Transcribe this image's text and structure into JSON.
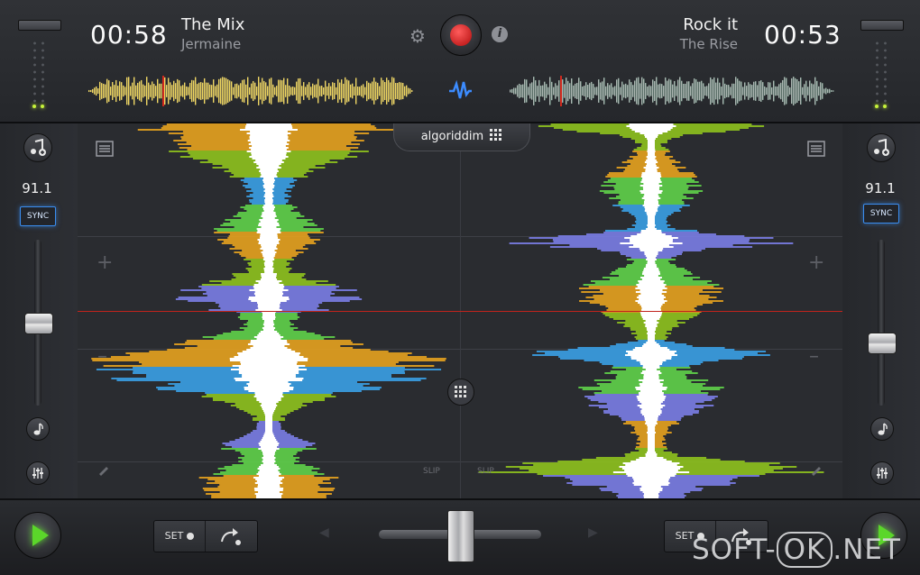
{
  "deck_a": {
    "time": "00:58",
    "title": "The Mix",
    "artist": "Jermaine",
    "bpm": "91.1",
    "sync_label": "SYNC",
    "set_label": "SET",
    "slip_label": "SLIP",
    "pitch_position": 0.5
  },
  "deck_b": {
    "time": "00:53",
    "title": "Rock it",
    "artist": "The Rise",
    "bpm": "91.1",
    "sync_label": "SYNC",
    "set_label": "SET",
    "slip_label": "SLIP",
    "pitch_position": 0.62
  },
  "logo": "algoriddim",
  "watermark": {
    "prefix": "SOFT-",
    "boxed": "OK",
    "suffix": ".NET"
  },
  "crossfader_position": 0.5,
  "colors": {
    "accent_blue": "#3a8df0",
    "record_red": "#c21414",
    "play_green": "#5bd62a",
    "playhead": "#c2231c"
  },
  "icons": [
    "gear-icon",
    "record-icon",
    "info-icon",
    "waveform-icon",
    "add-music-icon",
    "list-icon",
    "note-icon",
    "mixer-icon",
    "grid-icon",
    "play-icon",
    "jump-icon",
    "pencil-icon"
  ]
}
